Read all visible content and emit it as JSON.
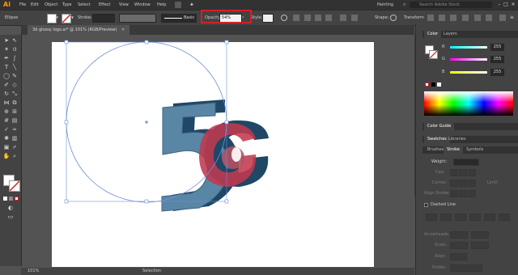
{
  "app": {
    "logo": "Ai",
    "workspace": "Painting",
    "search_placeholder": "Search Adobe Stock"
  },
  "menu": [
    "File",
    "Edit",
    "Object",
    "Type",
    "Select",
    "Effect",
    "View",
    "Window",
    "Help"
  ],
  "control_bar": {
    "selection": "Ellipse",
    "stroke_label": "Stroke:",
    "brush_label": "Basic",
    "opacity_label": "Opacity:",
    "opacity_value": "54%",
    "style_label": "Style:",
    "shape_label": "Shape:",
    "transform_label": "Transform"
  },
  "document_tab": "3d glossy logo.ai* @ 101% (RGB/Preview)",
  "status": {
    "zoom": "101%",
    "tool": "Selection"
  },
  "color_panel": {
    "tabs": [
      "Color",
      "Layers"
    ],
    "channels": [
      {
        "label": "R",
        "value": "255"
      },
      {
        "label": "G",
        "value": "255"
      },
      {
        "label": "B",
        "value": "255"
      }
    ],
    "guide_tab": "Color Guide"
  },
  "swatches_tabs": [
    "Swatches",
    "Libraries"
  ],
  "stroke_tabs": [
    "Brushes",
    "Stroke",
    "Symbols"
  ],
  "stroke_panel": {
    "weight_label": "Weight:",
    "cap_label": "Cap:",
    "corner_label": "Corner:",
    "limit_label": "Limit:",
    "align_label": "Align Stroke:",
    "dashed_label": "Dashed Line",
    "arrowheads_label": "Arrowheads:",
    "scale_label": "Scale:",
    "align2_label": "Align:",
    "profile_label": "Profile:"
  },
  "colors": {
    "highlight": "#d61f26",
    "logo_5": "#1f4766",
    "logo_5_face": "#5a86a6",
    "logo_o": "#c03a4f",
    "logo_o_front": "#b25062"
  }
}
